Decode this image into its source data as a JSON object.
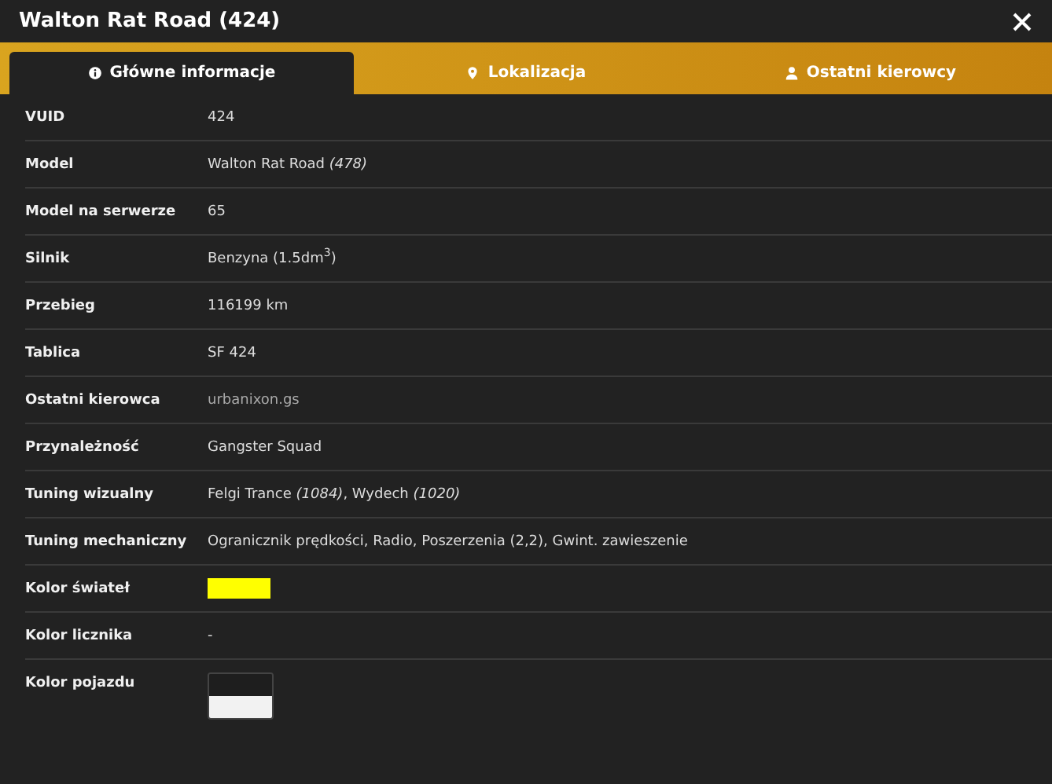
{
  "window": {
    "title": "Walton Rat Road (424)"
  },
  "tabs": [
    {
      "label": "Główne informacje",
      "kind": "info",
      "selected": true
    },
    {
      "label": "Lokalizacja",
      "kind": "location",
      "selected": false
    },
    {
      "label": "Ostatni kierowcy",
      "kind": "drivers",
      "selected": false
    }
  ],
  "rows": [
    {
      "label": "VUID",
      "kind": "text",
      "value": "424"
    },
    {
      "label": "Model",
      "kind": "text",
      "value": "Walton Rat Road *(478)*"
    },
    {
      "label": "Model na serwerze",
      "kind": "text",
      "value": "65"
    },
    {
      "label": "Silnik",
      "kind": "text",
      "value": "Benzyna (1.5dm$^{3}$)"
    },
    {
      "label": "Przebieg",
      "kind": "text",
      "value": "116199 km"
    },
    {
      "label": "Tablica",
      "kind": "text",
      "value": "SF 424"
    },
    {
      "label": "Ostatni kierowca",
      "kind": "link",
      "value": "urbanixon.gs"
    },
    {
      "label": "Przynależność",
      "kind": "text",
      "value": "Gangster Squad"
    },
    {
      "label": "Tuning wizualny",
      "kind": "text",
      "value": "Felgi Trance *(1084)*, Wydech *(1020)*"
    },
    {
      "label": "Tuning mechaniczny",
      "kind": "text",
      "value": "Ogranicznik prędkości, Radio, Poszerzenia (2,2), Gwint. zawieszenie"
    },
    {
      "label": "Kolor świateł",
      "kind": "swatch",
      "swatches": [
        {
          "color": "#ffff00"
        }
      ]
    },
    {
      "label": "Kolor licznika",
      "kind": "text",
      "value": "-"
    },
    {
      "label": "Kolor pojazdu",
      "kind": "swatch",
      "swatches": [
        {
          "color": "#1e1e1e"
        },
        {
          "color": "#f2f2f2"
        }
      ]
    }
  ]
}
